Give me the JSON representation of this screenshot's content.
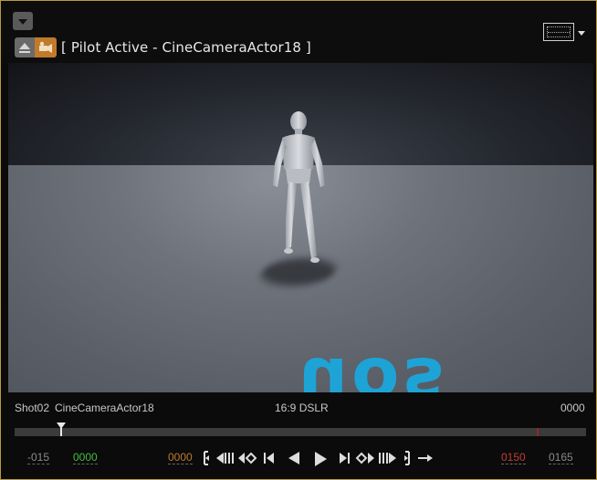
{
  "header": {
    "title": "[ Pilot Active - CineCameraActor18 ]",
    "icons": [
      "chevron-down-icon",
      "eject-icon",
      "pilot-icon",
      "layout-icon"
    ]
  },
  "viewport": {
    "floor_text": "uos"
  },
  "info_bar": {
    "shot": "Shot02",
    "camera": "CineCameraActor18",
    "filmback": "16:9 DSLR",
    "frame": "0000"
  },
  "timeline": {
    "playhead_fraction": 0.083,
    "end_fraction": 0.917
  },
  "controls": {
    "pre_roll": "-015",
    "start": "0000",
    "current": "0000",
    "end": "0150",
    "post_roll": "0165",
    "colors": {
      "pre_roll": "#8a8a8a",
      "start": "#3fbf3f",
      "current": "#c07a2a",
      "end": "#c83a3a",
      "post_roll": "#8a8a8a"
    }
  }
}
